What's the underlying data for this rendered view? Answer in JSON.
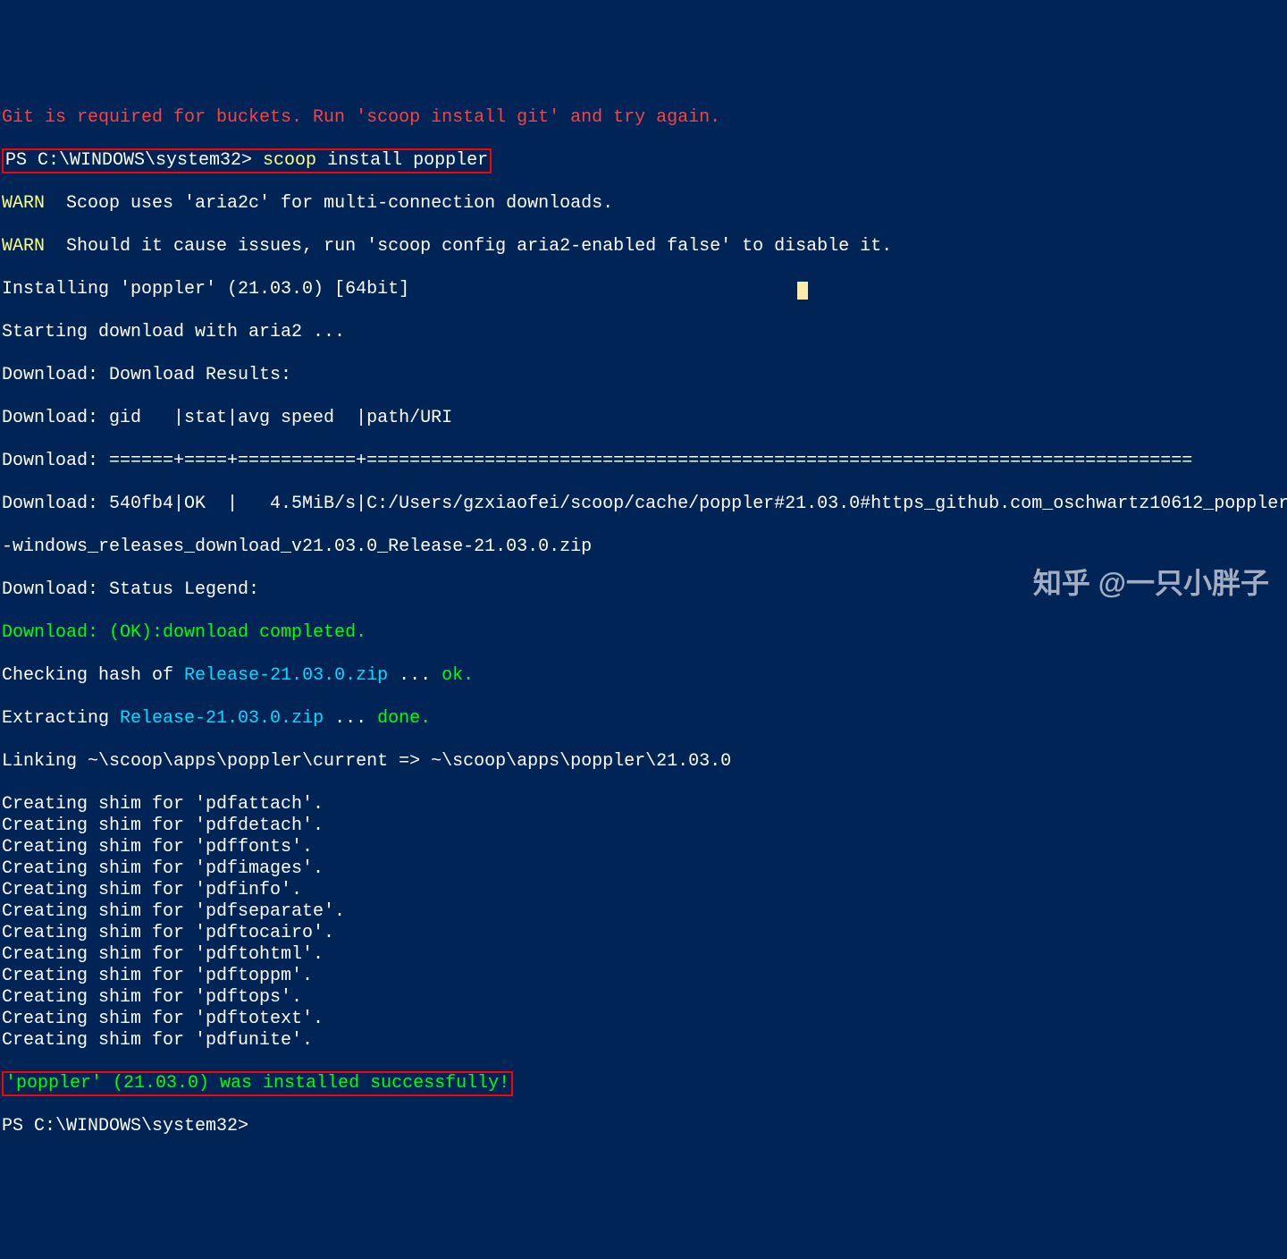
{
  "topErr": "Git is required for buckets. Run 'scoop install git' and try again.",
  "prompt1a": "PS C:\\WINDOWS\\system32> ",
  "cmd_scoop": "scoop",
  "cmd_rest": " install poppler",
  "warn_lbl": "WARN",
  "warn1": "  Scoop uses 'aria2c' for multi-connection downloads.",
  "warn2": "  Should it cause issues, run 'scoop config aria2-enabled false' to disable it.",
  "installing": "Installing 'poppler' (21.03.0) [64bit]",
  "startdl": "Starting download with aria2 ...",
  "dl_results": "Download: Download Results:",
  "dl_header": "Download: gid   |stat|avg speed  |path/URI",
  "dl_sep": "Download: ======+====+===========+=============================================================================",
  "dl_row_a": "Download: 540fb4|OK  |   4.5MiB/s|C:/Users/gzxiaofei/scoop/cache/poppler#21.03.0#https_github.com_oschwartz10612_poppler",
  "dl_row_b": "-windows_releases_download_v21.03.0_Release-21.03.0.zip",
  "dl_legend": "Download: Status Legend:",
  "dl_ok": "Download: (OK):download completed.",
  "check_a": "Checking hash of ",
  "check_file": "Release-21.03.0.zip",
  "check_dots": " ... ",
  "check_ok": "ok.",
  "ext_a": "Extracting ",
  "ext_done": "done.",
  "linking": "Linking ~\\scoop\\apps\\poppler\\current => ~\\scoop\\apps\\poppler\\21.03.0",
  "shims": [
    "Creating shim for 'pdfattach'.",
    "Creating shim for 'pdfdetach'.",
    "Creating shim for 'pdffonts'.",
    "Creating shim for 'pdfimages'.",
    "Creating shim for 'pdfinfo'.",
    "Creating shim for 'pdfseparate'.",
    "Creating shim for 'pdftocairo'.",
    "Creating shim for 'pdftohtml'.",
    "Creating shim for 'pdftoppm'.",
    "Creating shim for 'pdftops'.",
    "Creating shim for 'pdftotext'.",
    "Creating shim for 'pdfunite'."
  ],
  "success": "'poppler' (21.03.0) was installed successfully!",
  "prompt2": "PS C:\\WINDOWS\\system32>",
  "watermark": "知乎 @一只小胖子"
}
